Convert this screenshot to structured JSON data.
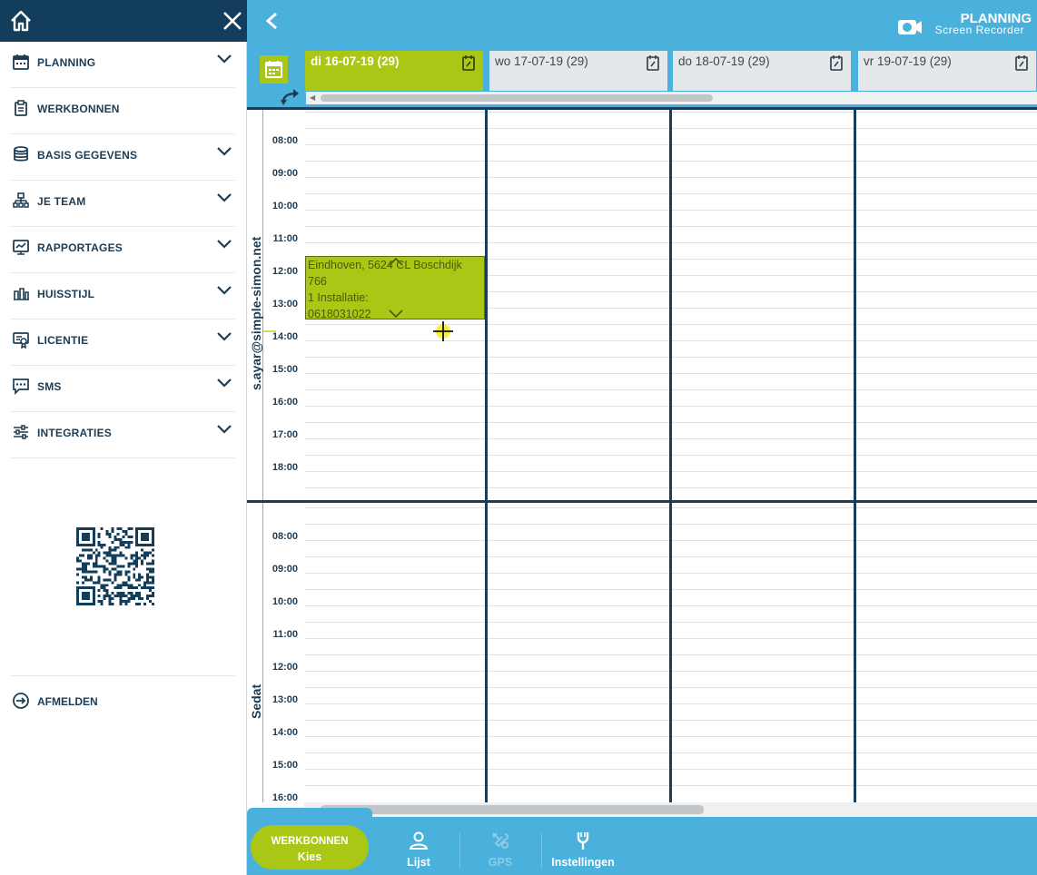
{
  "sidebar": {
    "menu": [
      {
        "label": "PLANNING",
        "icon": "calendar-icon",
        "has_children": true
      },
      {
        "label": "WERKBONNEN",
        "icon": "clipboard-icon",
        "has_children": false
      },
      {
        "label": "BASIS GEGEVENS",
        "icon": "database-icon",
        "has_children": true
      },
      {
        "label": "JE TEAM",
        "icon": "team-hierarchy-icon",
        "has_children": true
      },
      {
        "label": "RAPPORTAGES",
        "icon": "report-icon",
        "has_children": true
      },
      {
        "label": "HUISSTIJL",
        "icon": "brush-icon",
        "has_children": true
      },
      {
        "label": "LICENTIE",
        "icon": "certificate-icon",
        "has_children": true
      },
      {
        "label": "SMS",
        "icon": "chat-icon",
        "has_children": true
      },
      {
        "label": "INTEGRATIES",
        "icon": "sliders-icon",
        "has_children": true
      }
    ],
    "logout_label": "AFMELDEN"
  },
  "header": {
    "watermark_title": "PLANNING",
    "watermark_sub": "Screen Recorder"
  },
  "days": [
    {
      "label": "di 16-07-19 (29)",
      "selected": true
    },
    {
      "label": "wo 17-07-19 (29)",
      "selected": false
    },
    {
      "label": "do 18-07-19 (29)",
      "selected": false
    },
    {
      "label": "vr 19-07-19 (29)",
      "selected": false
    }
  ],
  "employees": [
    {
      "name": "s.ayar@simple-simon.net",
      "hours": [
        "08:00",
        "09:00",
        "10:00",
        "11:00",
        "12:00",
        "13:00",
        "14:00",
        "15:00",
        "16:00",
        "17:00",
        "18:00"
      ]
    },
    {
      "name": "Sedat",
      "hours": [
        "08:00",
        "09:00",
        "10:00",
        "11:00",
        "12:00",
        "13:00",
        "14:00",
        "15:00",
        "16:00"
      ]
    }
  ],
  "event": {
    "lines": [
      "Eindhoven, 5624 CL Boschdijk",
      "766",
      "1 Installatie:",
      "0618031022"
    ],
    "color": "#a9c714"
  },
  "bottom_nav": {
    "primary_line1": "WERKBONNEN",
    "primary_line2": "Kies",
    "items": [
      {
        "label": "Lijst",
        "icon": "person-icon",
        "enabled": true
      },
      {
        "label": "GPS",
        "icon": "gps-tools-icon",
        "enabled": false
      },
      {
        "label": "Instellingen",
        "icon": "wrench-icon",
        "enabled": true
      }
    ]
  },
  "colors": {
    "accent_green": "#a9c714",
    "header_blue": "#4ab0dc",
    "navy": "#123d5b"
  }
}
